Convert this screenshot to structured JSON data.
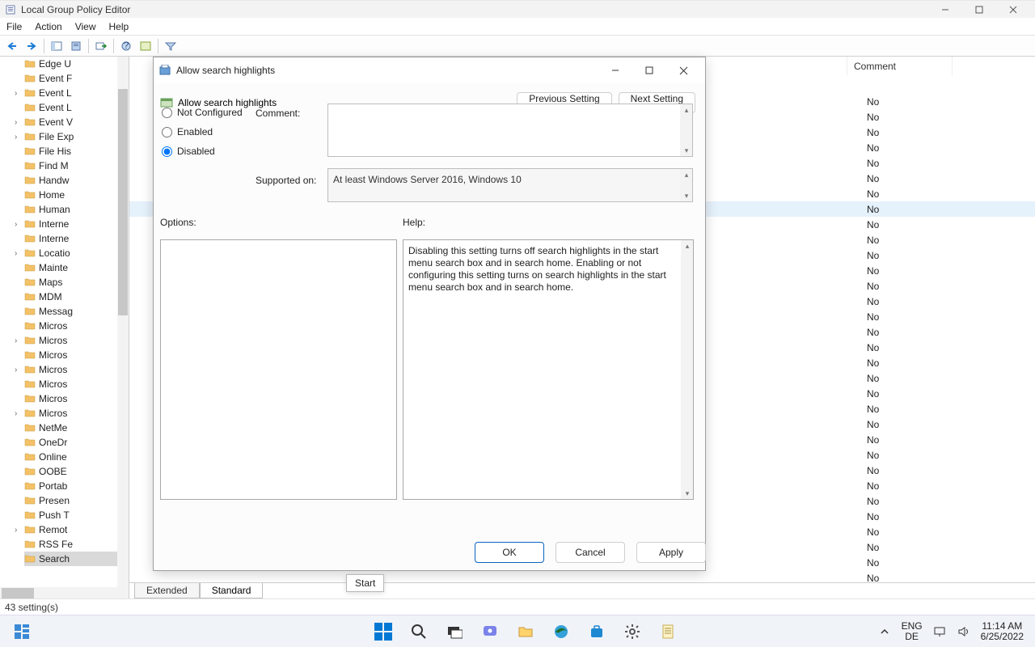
{
  "window": {
    "title": "Local Group Policy Editor",
    "status": "43 setting(s)"
  },
  "menubar": [
    "File",
    "Action",
    "View",
    "Help"
  ],
  "tree": {
    "items": [
      {
        "label": "Edge U",
        "exp": false
      },
      {
        "label": "Event F",
        "exp": false
      },
      {
        "label": "Event L",
        "exp": true
      },
      {
        "label": "Event L",
        "exp": false
      },
      {
        "label": "Event V",
        "exp": true
      },
      {
        "label": "File Exp",
        "exp": true
      },
      {
        "label": "File His",
        "exp": false
      },
      {
        "label": "Find M",
        "exp": false
      },
      {
        "label": "Handw",
        "exp": false
      },
      {
        "label": "Home",
        "exp": false
      },
      {
        "label": "Human",
        "exp": false
      },
      {
        "label": "Interne",
        "exp": true
      },
      {
        "label": "Interne",
        "exp": false
      },
      {
        "label": "Locatio",
        "exp": true
      },
      {
        "label": "Mainte",
        "exp": false
      },
      {
        "label": "Maps",
        "exp": false
      },
      {
        "label": "MDM",
        "exp": false
      },
      {
        "label": "Messag",
        "exp": false
      },
      {
        "label": "Micros",
        "exp": false
      },
      {
        "label": "Micros",
        "exp": true
      },
      {
        "label": "Micros",
        "exp": false
      },
      {
        "label": "Micros",
        "exp": true
      },
      {
        "label": "Micros",
        "exp": false
      },
      {
        "label": "Micros",
        "exp": false
      },
      {
        "label": "Micros",
        "exp": true
      },
      {
        "label": "NetMe",
        "exp": false
      },
      {
        "label": "OneDr",
        "exp": false
      },
      {
        "label": "Online",
        "exp": false
      },
      {
        "label": "OOBE",
        "exp": false
      },
      {
        "label": "Portab",
        "exp": false
      },
      {
        "label": "Presen",
        "exp": false
      },
      {
        "label": "Push T",
        "exp": false
      },
      {
        "label": "Remot",
        "exp": true
      },
      {
        "label": "RSS Fe",
        "exp": false
      },
      {
        "label": "Search",
        "exp": false,
        "selected": true
      }
    ]
  },
  "detail": {
    "header_cols": [
      "",
      "Comment"
    ],
    "tabs": [
      "Extended",
      "Standard"
    ],
    "active_tab": "Standard",
    "rows": [
      {
        "comment": "No"
      },
      {
        "comment": "No"
      },
      {
        "comment": "No"
      },
      {
        "comment": "No"
      },
      {
        "comment": "No"
      },
      {
        "comment": "No"
      },
      {
        "comment": "No"
      },
      {
        "comment": "No",
        "selected": true
      },
      {
        "comment": "No"
      },
      {
        "comment": "No"
      },
      {
        "comment": "No"
      },
      {
        "comment": "No"
      },
      {
        "comment": "No"
      },
      {
        "comment": "No"
      },
      {
        "comment": "No"
      },
      {
        "comment": "No"
      },
      {
        "comment": "No"
      },
      {
        "comment": "No"
      },
      {
        "comment": "No"
      },
      {
        "comment": "No"
      },
      {
        "comment": "No"
      },
      {
        "comment": "No"
      },
      {
        "comment": "No"
      },
      {
        "comment": "No"
      },
      {
        "comment": "No"
      },
      {
        "comment": "No"
      },
      {
        "comment": "No"
      },
      {
        "comment": "No"
      },
      {
        "comment": "No"
      },
      {
        "comment": "No"
      },
      {
        "comment": "No"
      },
      {
        "comment": "No"
      }
    ]
  },
  "dialog": {
    "title": "Allow search highlights",
    "policy_name": "Allow search highlights",
    "prev": "Previous Setting",
    "next": "Next Setting",
    "radios": {
      "not_configured": "Not Configured",
      "enabled": "Enabled",
      "disabled": "Disabled"
    },
    "selected": "disabled",
    "comment_label": "Comment:",
    "supported_label": "Supported on:",
    "supported_text": "At least Windows Server 2016, Windows 10",
    "options_label": "Options:",
    "help_label": "Help:",
    "help_text": "Disabling this setting turns off search highlights in the start menu search box and in search home. Enabling or not configuring this setting turns on search highlights in the start menu search box and in search home.",
    "buttons": {
      "ok": "OK",
      "cancel": "Cancel",
      "apply": "Apply"
    }
  },
  "tooltip": "Start",
  "taskbar": {
    "lang1": "ENG",
    "lang2": "DE",
    "time": "11:14 AM",
    "date": "6/25/2022"
  }
}
